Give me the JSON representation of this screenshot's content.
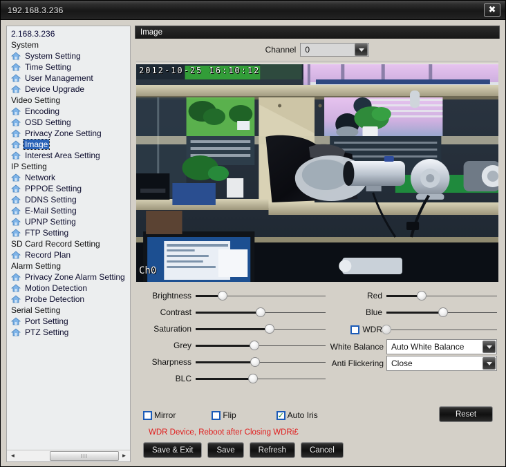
{
  "window": {
    "title": "192.168.3.236",
    "close_label": "✖"
  },
  "sidebar": {
    "root_label": "2.168.3.236",
    "nodes": [
      {
        "type": "group",
        "label": "System"
      },
      {
        "type": "item",
        "label": "System Setting"
      },
      {
        "type": "item",
        "label": "Time Setting"
      },
      {
        "type": "item",
        "label": "User Management"
      },
      {
        "type": "item",
        "label": "Device Upgrade"
      },
      {
        "type": "group",
        "label": "Video Setting"
      },
      {
        "type": "item",
        "label": "Encoding"
      },
      {
        "type": "item",
        "label": "OSD Setting"
      },
      {
        "type": "item",
        "label": "Privacy Zone Setting"
      },
      {
        "type": "item",
        "label": "Image",
        "selected": true
      },
      {
        "type": "item",
        "label": "Interest Area Setting"
      },
      {
        "type": "group",
        "label": "IP Setting"
      },
      {
        "type": "item",
        "label": "Network"
      },
      {
        "type": "item",
        "label": "PPPOE Setting"
      },
      {
        "type": "item",
        "label": "DDNS Setting"
      },
      {
        "type": "item",
        "label": "E-Mail Setting"
      },
      {
        "type": "item",
        "label": "UPNP Setting"
      },
      {
        "type": "item",
        "label": "FTP Setting"
      },
      {
        "type": "group",
        "label": "SD Card Record Setting"
      },
      {
        "type": "item",
        "label": "Record Plan"
      },
      {
        "type": "group",
        "label": "Alarm Setting"
      },
      {
        "type": "item",
        "label": "Privacy Zone Alarm Setting"
      },
      {
        "type": "item",
        "label": "Motion Detection"
      },
      {
        "type": "item",
        "label": "Probe Detection"
      },
      {
        "type": "group",
        "label": "Serial Setting"
      },
      {
        "type": "item",
        "label": "Port Setting"
      },
      {
        "type": "item",
        "label": "PTZ Setting"
      }
    ],
    "scrollbar": {
      "left_arrow": "◄",
      "right_arrow": "►",
      "grip": "III"
    }
  },
  "main": {
    "panel_title": "Image",
    "channel": {
      "label": "Channel",
      "value": "0"
    },
    "video": {
      "osd_timestamp": "2012-10-25 16:10:12",
      "osd_channel": "Ch0"
    },
    "sliders_left": [
      {
        "label": "Brightness",
        "percent": 21
      },
      {
        "label": "Contrast",
        "percent": 50
      },
      {
        "label": "Saturation",
        "percent": 57
      },
      {
        "label": "Grey",
        "percent": 45
      },
      {
        "label": "Sharpness",
        "percent": 46
      },
      {
        "label": "BLC",
        "percent": 44
      }
    ],
    "sliders_right": [
      {
        "label": "Red",
        "percent": 32
      },
      {
        "label": "Blue",
        "percent": 51
      }
    ],
    "wdr": {
      "label": "WDR",
      "checked": false,
      "percent": 0
    },
    "white_balance": {
      "label": "White Balance",
      "value": "Auto White Balance"
    },
    "anti_flickering": {
      "label": "Anti Flickering",
      "value": "Close"
    },
    "checkboxes": [
      {
        "label": "Mirror",
        "checked": false
      },
      {
        "label": "Flip",
        "checked": false
      },
      {
        "label": "Auto Iris",
        "checked": true
      }
    ],
    "reset_label": "Reset",
    "warning": "WDR Device, Reboot after Closing WDRi£",
    "buttons": [
      {
        "label": "Save & Exit"
      },
      {
        "label": "Save"
      },
      {
        "label": "Refresh"
      },
      {
        "label": "Cancel"
      }
    ]
  },
  "colors": {
    "accent_selection": "#2a63b8",
    "warning": "#e01b1b",
    "checkbox_border": "#1b5bb8",
    "check_tick": "#117a1b",
    "panel_bg": "#d4d0c8",
    "tree_bg": "#eceeef"
  }
}
